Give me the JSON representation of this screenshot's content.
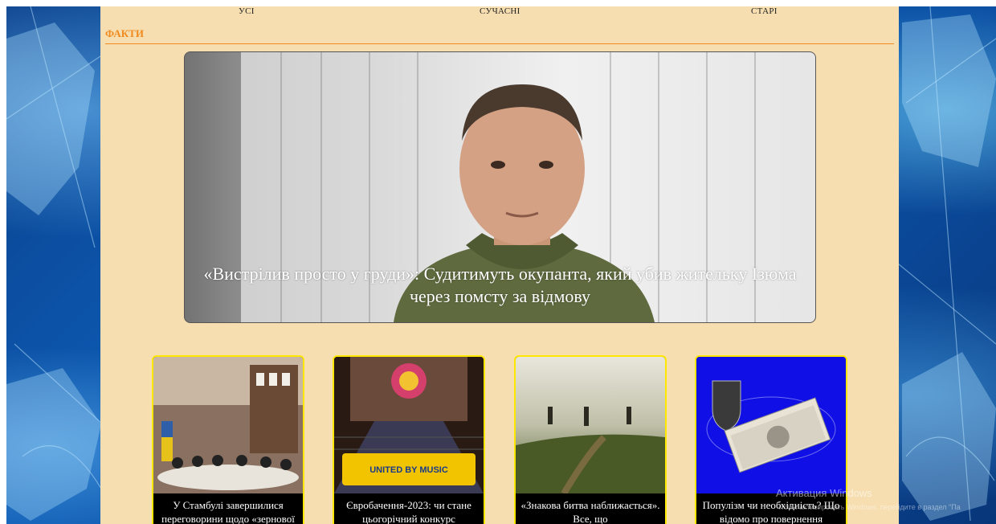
{
  "nav": {
    "all": "УСІ",
    "modern": "СУЧАСНІ",
    "old": "СТАРІ"
  },
  "section": {
    "title": "ФАКТИ"
  },
  "hero": {
    "caption": "«Вистрілив просто у груди»: Судитимуть окупанта, який убив жительку Ізюма через помсту за відмову"
  },
  "cards": [
    {
      "caption": "У Стамбулі завершилися переговорини щодо «зернової"
    },
    {
      "caption": "Євробачення-2023: чи стане цьогорічний конкурс"
    },
    {
      "caption": "«Знакова битва наближається». Все, що"
    },
    {
      "caption": "Популізм чи необхідність? Що відомо про повернення"
    }
  ],
  "os": {
    "activation_title": "Активация Windows",
    "activation_sub": "Чтобы активировать Windows, перейдите в раздел \"Па"
  },
  "colors": {
    "accent": "#f08a1e",
    "panel": "#f6deb0",
    "card_border": "#ffe800"
  }
}
